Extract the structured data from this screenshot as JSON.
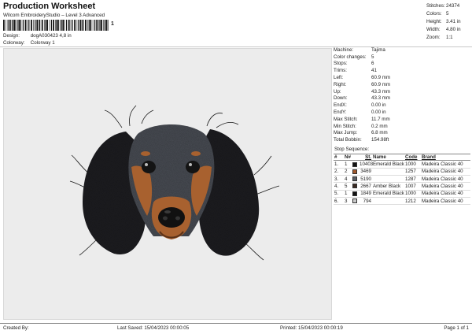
{
  "header": {
    "title": "Production Worksheet",
    "subtitle": "Wilcom EmbroideryStudio – Level 3 Advanced",
    "barcode_tail": "1",
    "design_label": "Design:",
    "design_value": "dogA030423 4,8 in",
    "colorway_label": "Colorway:",
    "colorway_value": "Colorway 1"
  },
  "summary": [
    {
      "k": "Stitches:",
      "v": "24374"
    },
    {
      "k": "Colors:",
      "v": "5"
    },
    {
      "k": "Height:",
      "v": "3.41 in"
    },
    {
      "k": "Width:",
      "v": "4.80 in"
    },
    {
      "k": "Zoom:",
      "v": "1:1"
    }
  ],
  "info": [
    {
      "k": "Machine:",
      "v": "Tajima"
    },
    {
      "k": "Color changes:",
      "v": "5"
    },
    {
      "k": "Stops:",
      "v": "6"
    },
    {
      "k": "Trims:",
      "v": "41"
    },
    {
      "k": "Left:",
      "v": "60.9 mm"
    },
    {
      "k": "Right:",
      "v": "60.9 mm"
    },
    {
      "k": "Up:",
      "v": "43.3 mm"
    },
    {
      "k": "Down:",
      "v": "43.3 mm"
    },
    {
      "k": "EndX:",
      "v": "0.00 in"
    },
    {
      "k": "EndY:",
      "v": "0.00 in"
    },
    {
      "k": "Max Stitch:",
      "v": "11.7 mm"
    },
    {
      "k": "Min Stitch:",
      "v": "0.2 mm"
    },
    {
      "k": "Max Jump:",
      "v": "6.8 mm"
    },
    {
      "k": "Total Bobbin:",
      "v": "154.98ft"
    }
  ],
  "stop_sequence": {
    "title": "Stop Sequence:",
    "headers": {
      "no": "#",
      "n": "N#",
      "st": "St.",
      "name": "Name",
      "code": "Code",
      "brand": "Brand"
    },
    "rows": [
      {
        "no": "1.",
        "n": "1",
        "color": "#111111",
        "st": "10403",
        "name": "Emerald Black",
        "code": "1000",
        "brand": "Madeira Classic 40"
      },
      {
        "no": "2.",
        "n": "2",
        "color": "#a0582c",
        "st": "3469",
        "name": "",
        "code": "1257",
        "brand": "Madeira Classic 40"
      },
      {
        "no": "3.",
        "n": "4",
        "color": "#5a5e66",
        "st": "5190",
        "name": "",
        "code": "1287",
        "brand": "Madeira Classic 40"
      },
      {
        "no": "4.",
        "n": "5",
        "color": "#3a2a22",
        "st": "2667",
        "name": "Amber Black",
        "code": "1007",
        "brand": "Madeira Classic 40"
      },
      {
        "no": "5.",
        "n": "1",
        "color": "#111111",
        "st": "1849",
        "name": "Emerald Black",
        "code": "1000",
        "brand": "Madeira Classic 40"
      },
      {
        "no": "6.",
        "n": "3",
        "color": "#c9c9c9",
        "st": "794",
        "name": "",
        "code": "1212",
        "brand": "Madeira Classic 40"
      }
    ]
  },
  "footer": {
    "created_by": "Created By:",
    "last_saved": "Last Saved: 15/04/2023 00:00:05",
    "printed": "Printed: 15/04/2023 00:00:19",
    "page": "Page 1 of 1"
  },
  "colors": {
    "canvas_bg": "#ececec",
    "fur_dark": "#1c1c1f",
    "fur_gray": "#6b6f78",
    "fur_tan": "#a8612f",
    "nose": "#111111"
  }
}
